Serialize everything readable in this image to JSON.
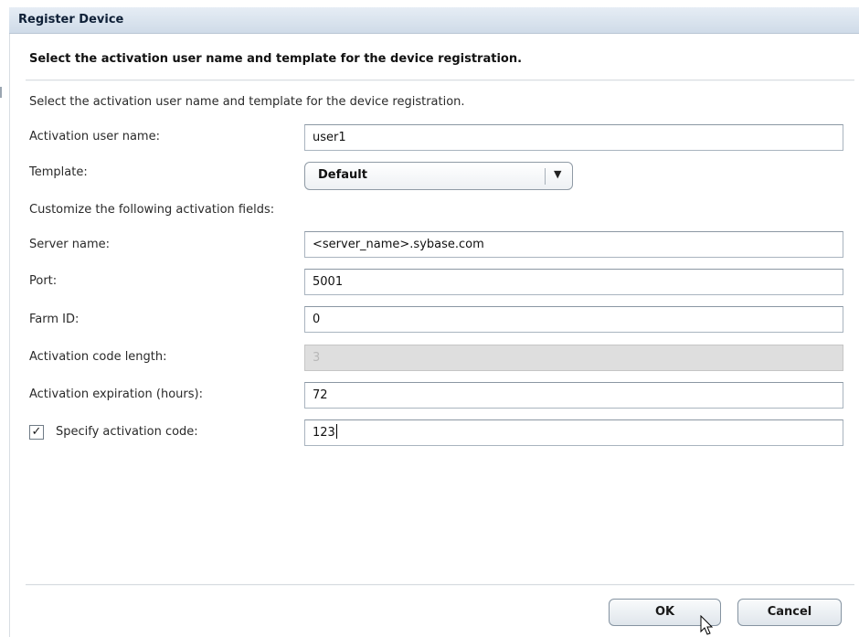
{
  "dialog": {
    "title": "Register Device",
    "instruction": "Select the activation user name and template for the device registration.",
    "description": "Select the activation user name and template for the device registration."
  },
  "form": {
    "activation_user_name": {
      "label": "Activation user name:",
      "value": "user1"
    },
    "template": {
      "label": "Template:",
      "value": "Default",
      "icon": "dropdown-arrow-icon"
    },
    "customize_heading": "Customize the following activation fields:",
    "server_name": {
      "label": "Server name:",
      "value": "<server_name>.sybase.com"
    },
    "port": {
      "label": "Port:",
      "value": "5001"
    },
    "farm_id": {
      "label": "Farm ID:",
      "value": "0"
    },
    "activation_code_length": {
      "label": "Activation code length:",
      "value": "3",
      "disabled": true
    },
    "activation_expiration": {
      "label": "Activation expiration (hours):",
      "value": "72"
    },
    "specify_activation_code": {
      "label": "Specify activation code:",
      "checked": true,
      "value": "123"
    }
  },
  "buttons": {
    "ok": "OK",
    "cancel": "Cancel"
  },
  "colors": {
    "titlebar": "#d6e0eb",
    "disabled_field": "#dedede",
    "button_border": "#8593a1"
  }
}
